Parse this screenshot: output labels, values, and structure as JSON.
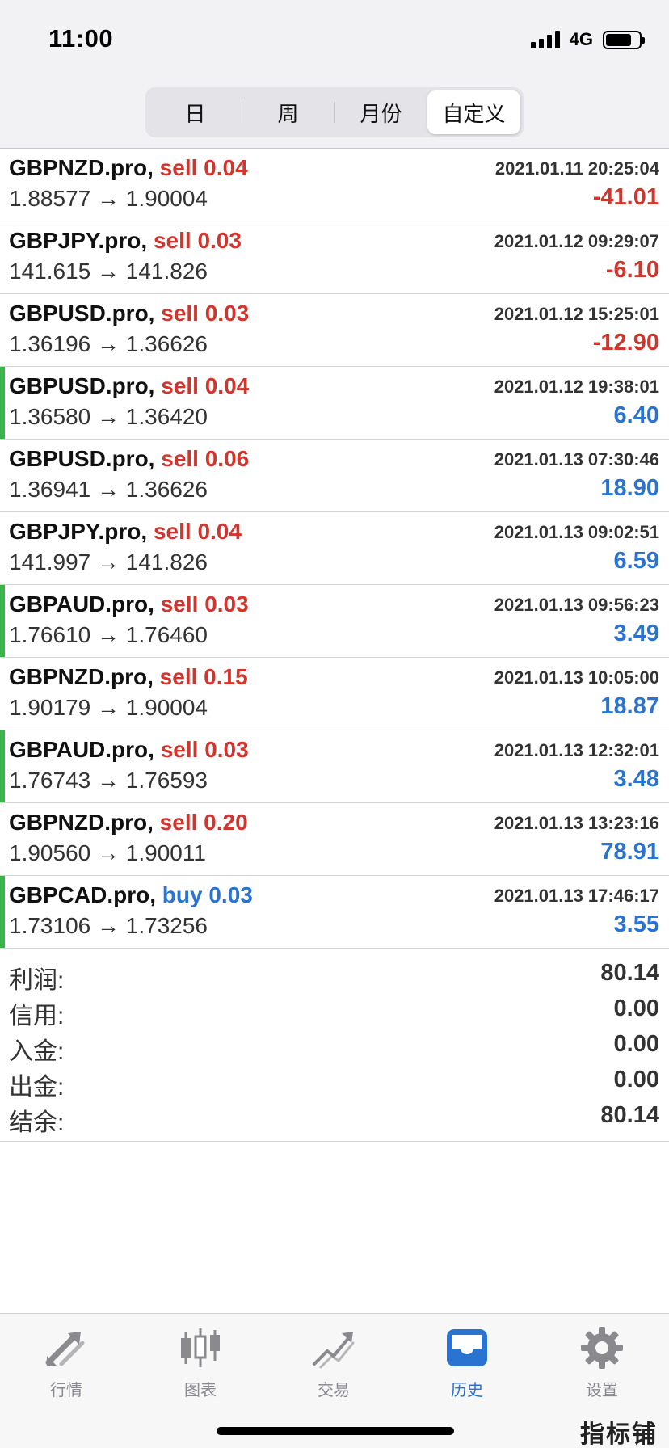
{
  "status_bar": {
    "time": "11:00",
    "network": "4G"
  },
  "period_tabs": [
    {
      "label": "日",
      "active": false
    },
    {
      "label": "周",
      "active": false
    },
    {
      "label": "月份",
      "active": false
    },
    {
      "label": "自定义",
      "active": true
    }
  ],
  "trades": [
    {
      "symbol": "GBPNZD.pro,",
      "side": "sell",
      "volume": "0.04",
      "time": "2021.01.11 20:25:04",
      "prices": "1.88577 → 1.90004",
      "profit": "-41.01",
      "marked": false
    },
    {
      "symbol": "GBPJPY.pro,",
      "side": "sell",
      "volume": "0.03",
      "time": "2021.01.12 09:29:07",
      "prices": "141.615 → 141.826",
      "profit": "-6.10",
      "marked": false
    },
    {
      "symbol": "GBPUSD.pro,",
      "side": "sell",
      "volume": "0.03",
      "time": "2021.01.12 15:25:01",
      "prices": "1.36196 → 1.36626",
      "profit": "-12.90",
      "marked": false
    },
    {
      "symbol": "GBPUSD.pro,",
      "side": "sell",
      "volume": "0.04",
      "time": "2021.01.12 19:38:01",
      "prices": "1.36580 → 1.36420",
      "profit": "6.40",
      "marked": true
    },
    {
      "symbol": "GBPUSD.pro,",
      "side": "sell",
      "volume": "0.06",
      "time": "2021.01.13 07:30:46",
      "prices": "1.36941 → 1.36626",
      "profit": "18.90",
      "marked": false
    },
    {
      "symbol": "GBPJPY.pro,",
      "side": "sell",
      "volume": "0.04",
      "time": "2021.01.13 09:02:51",
      "prices": "141.997 → 141.826",
      "profit": "6.59",
      "marked": false
    },
    {
      "symbol": "GBPAUD.pro,",
      "side": "sell",
      "volume": "0.03",
      "time": "2021.01.13 09:56:23",
      "prices": "1.76610 → 1.76460",
      "profit": "3.49",
      "marked": true
    },
    {
      "symbol": "GBPNZD.pro,",
      "side": "sell",
      "volume": "0.15",
      "time": "2021.01.13 10:05:00",
      "prices": "1.90179 → 1.90004",
      "profit": "18.87",
      "marked": false
    },
    {
      "symbol": "GBPAUD.pro,",
      "side": "sell",
      "volume": "0.03",
      "time": "2021.01.13 12:32:01",
      "prices": "1.76743 → 1.76593",
      "profit": "3.48",
      "marked": true
    },
    {
      "symbol": "GBPNZD.pro,",
      "side": "sell",
      "volume": "0.20",
      "time": "2021.01.13 13:23:16",
      "prices": "1.90560 → 1.90011",
      "profit": "78.91",
      "marked": false
    },
    {
      "symbol": "GBPCAD.pro,",
      "side": "buy",
      "volume": "0.03",
      "time": "2021.01.13 17:46:17",
      "prices": "1.73106 → 1.73256",
      "profit": "3.55",
      "marked": true
    }
  ],
  "summary": [
    {
      "label": "利润:",
      "value": "80.14"
    },
    {
      "label": "信用:",
      "value": "0.00"
    },
    {
      "label": "入金:",
      "value": "0.00"
    },
    {
      "label": "出金:",
      "value": "0.00"
    },
    {
      "label": "结余:",
      "value": "80.14"
    }
  ],
  "tab_bar": [
    {
      "label": "行情",
      "icon": "quotes-arrows-icon",
      "active": false
    },
    {
      "label": "图表",
      "icon": "candlestick-chart-icon",
      "active": false
    },
    {
      "label": "交易",
      "icon": "trade-trend-icon",
      "active": false
    },
    {
      "label": "历史",
      "icon": "history-tray-icon",
      "active": true
    },
    {
      "label": "设置",
      "icon": "gear-icon",
      "active": false
    }
  ],
  "watermark": "指标铺",
  "colors": {
    "sell": "#d0362d",
    "buy": "#2b73d0",
    "loss": "#d0362d",
    "gain": "#2b73d0",
    "marker": "#3ab34a",
    "active_tab": "#2b73d0",
    "inactive_tab": "#8a8a8e"
  }
}
